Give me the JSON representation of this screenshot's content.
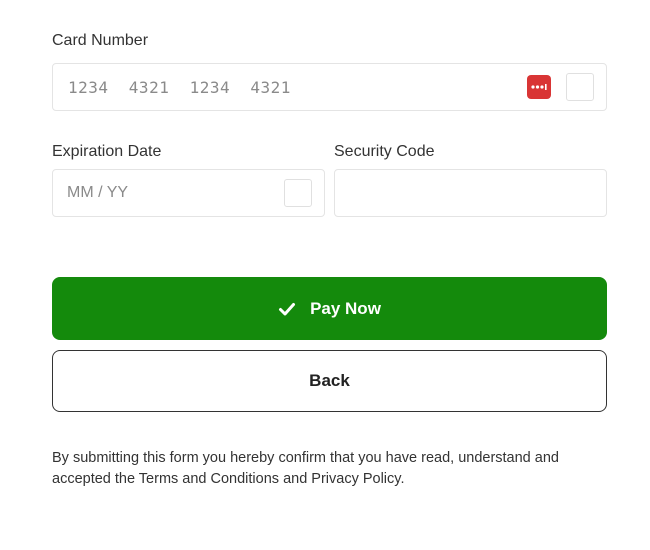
{
  "card_number": {
    "label": "Card Number",
    "placeholder": "1234  4321  1234  4321",
    "value": "",
    "brand_icon": "card-brand-icon",
    "brand_color": "#d93535"
  },
  "expiration_date": {
    "label": "Expiration Date",
    "placeholder": "MM / YY",
    "value": ""
  },
  "security_code": {
    "label": "Security Code",
    "placeholder": "",
    "value": ""
  },
  "pay_button": {
    "label": "Pay Now",
    "icon": "check-icon",
    "color": "#148a0c"
  },
  "back_button": {
    "label": "Back"
  },
  "disclaimer": "By submitting this form you hereby confirm that you have read, understand and accepted the Terms and Conditions and Privacy Policy."
}
